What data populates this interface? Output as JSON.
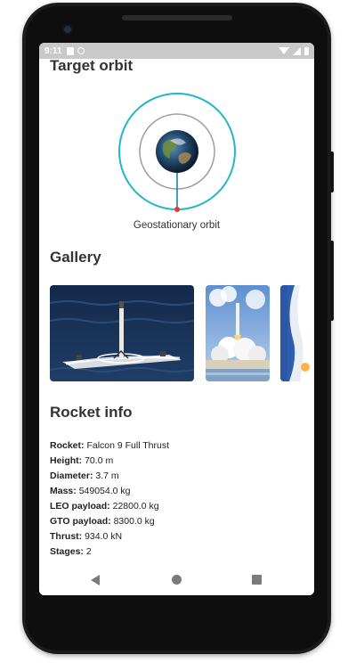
{
  "status_bar": {
    "time": "9:11",
    "left_icons": [
      "sd-card-icon",
      "sync-icon"
    ],
    "right_icons": [
      "wifi-icon",
      "signal-icon",
      "battery-icon"
    ]
  },
  "orbit": {
    "section_title": "Target orbit",
    "caption": "Geostationary orbit",
    "colors": {
      "outer_ring": "#1fb8c9",
      "inner_ring": "#9e9e9e",
      "marker": "#e53935"
    }
  },
  "gallery": {
    "section_title": "Gallery",
    "images": [
      {
        "name": "landing-barge-photo"
      },
      {
        "name": "launch-pad-photo"
      },
      {
        "name": "launch-smoke-photo"
      }
    ]
  },
  "rocket_info": {
    "section_title": "Rocket info",
    "rows": [
      {
        "label": "Rocket:",
        "value": "Falcon 9 Full Thrust"
      },
      {
        "label": "Height:",
        "value": "70.0 m"
      },
      {
        "label": "Diameter:",
        "value": "3.7 m"
      },
      {
        "label": "Mass:",
        "value": "549054.0 kg"
      },
      {
        "label": "LEO payload:",
        "value": "22800.0 kg"
      },
      {
        "label": "GTO payload:",
        "value": "8300.0 kg"
      },
      {
        "label": "Thrust:",
        "value": "934.0 kN"
      },
      {
        "label": "Stages:",
        "value": "2"
      }
    ]
  },
  "nav_bar": {
    "icons": [
      "back-icon",
      "home-icon",
      "recents-icon"
    ]
  }
}
